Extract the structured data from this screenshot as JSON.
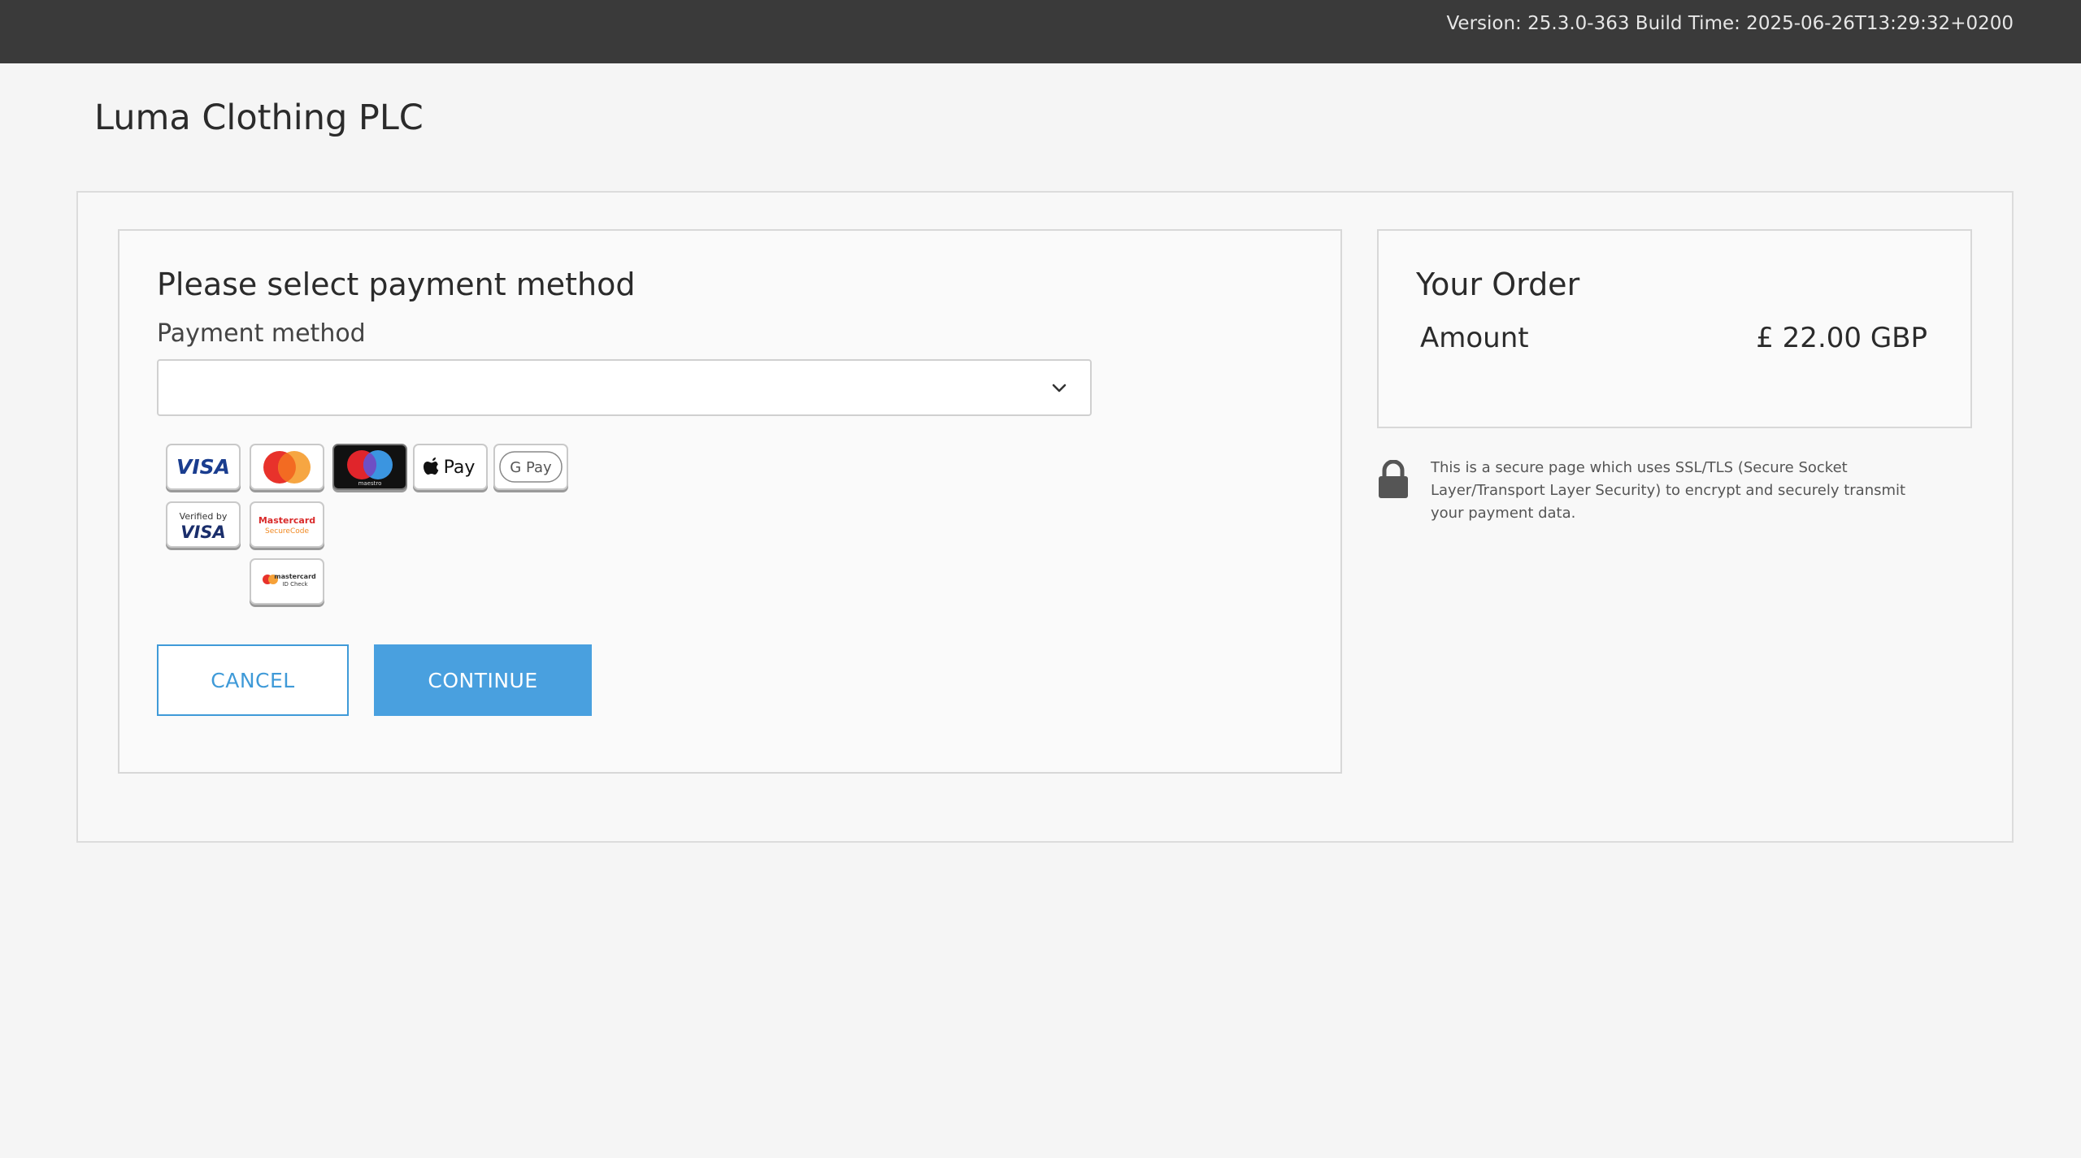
{
  "header": {
    "version_text": "Version: 25.3.0-363 Build Time: 2025-06-26T13:29:32+0200"
  },
  "merchant": {
    "name": "Luma Clothing PLC"
  },
  "payment": {
    "title": "Please select payment method",
    "method_label": "Payment method",
    "method_value": "",
    "card_logos": {
      "visa": "VISA",
      "apple_pay": "Pay",
      "google_pay": "G Pay",
      "verified_by": "Verified by",
      "verified_visa": "VISA",
      "mc_securecode_line1": "Mastercard",
      "mc_securecode_line2": "SecureCode",
      "maestro": "maestro",
      "mc_idcheck_line1": "mastercard",
      "mc_idcheck_line2": "ID Check"
    },
    "cancel_label": "CANCEL",
    "continue_label": "CONTINUE"
  },
  "order": {
    "title": "Your Order",
    "amount_label": "Amount",
    "amount_value": "£ 22.00 GBP"
  },
  "security": {
    "text": "This is a secure page which uses SSL/TLS (Secure Socket Layer/Transport Layer Security) to encrypt and securely transmit your payment data."
  },
  "colors": {
    "topbar": "#3a3a3a",
    "accent": "#49a0df",
    "background": "#f5f5f5"
  }
}
